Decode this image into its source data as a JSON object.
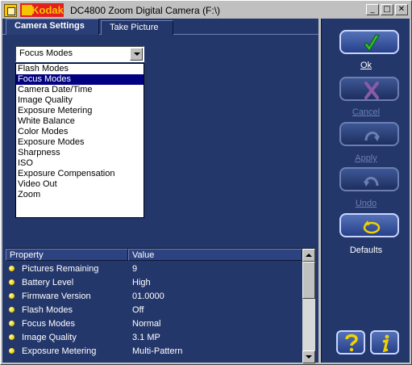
{
  "window": {
    "brand": "Kodak",
    "title": "DC4800 Zoom Digital Camera (F:\\)",
    "buttons": {
      "minimize": "_",
      "maximize": "□",
      "close": "✕"
    }
  },
  "tabs": [
    {
      "label": "Camera Settings",
      "active": true
    },
    {
      "label": "Take Picture",
      "active": false
    }
  ],
  "combo": {
    "selected": "Focus Modes"
  },
  "dropdown": {
    "items": [
      "Flash Modes",
      "Focus Modes",
      "Camera Date/Time",
      "Image Quality",
      "Exposure Metering",
      "White Balance",
      "Color Modes",
      "Exposure Modes",
      "Sharpness",
      "ISO",
      "Exposure Compensation",
      "Video Out",
      "Zoom"
    ],
    "selected_index": 1
  },
  "properties": {
    "header": {
      "property": "Property",
      "value": "Value"
    },
    "rows": [
      {
        "property": "Pictures Remaining",
        "value": "9"
      },
      {
        "property": "Battery Level",
        "value": "High"
      },
      {
        "property": "Firmware Version",
        "value": "01.0000"
      },
      {
        "property": "Flash Modes",
        "value": "Off"
      },
      {
        "property": "Focus Modes",
        "value": "Normal"
      },
      {
        "property": "Image Quality",
        "value": "3.1 MP"
      },
      {
        "property": "Exposure Metering",
        "value": "Multi-Pattern"
      }
    ]
  },
  "actions": {
    "ok": "Ok",
    "cancel": "Cancel",
    "apply": "Apply",
    "undo": "Undo",
    "defaults": "Defaults"
  },
  "colors": {
    "panel": "#24376b",
    "accent_green": "#2fbf2f",
    "accent_yellow": "#f2d200",
    "selection": "#000080"
  }
}
